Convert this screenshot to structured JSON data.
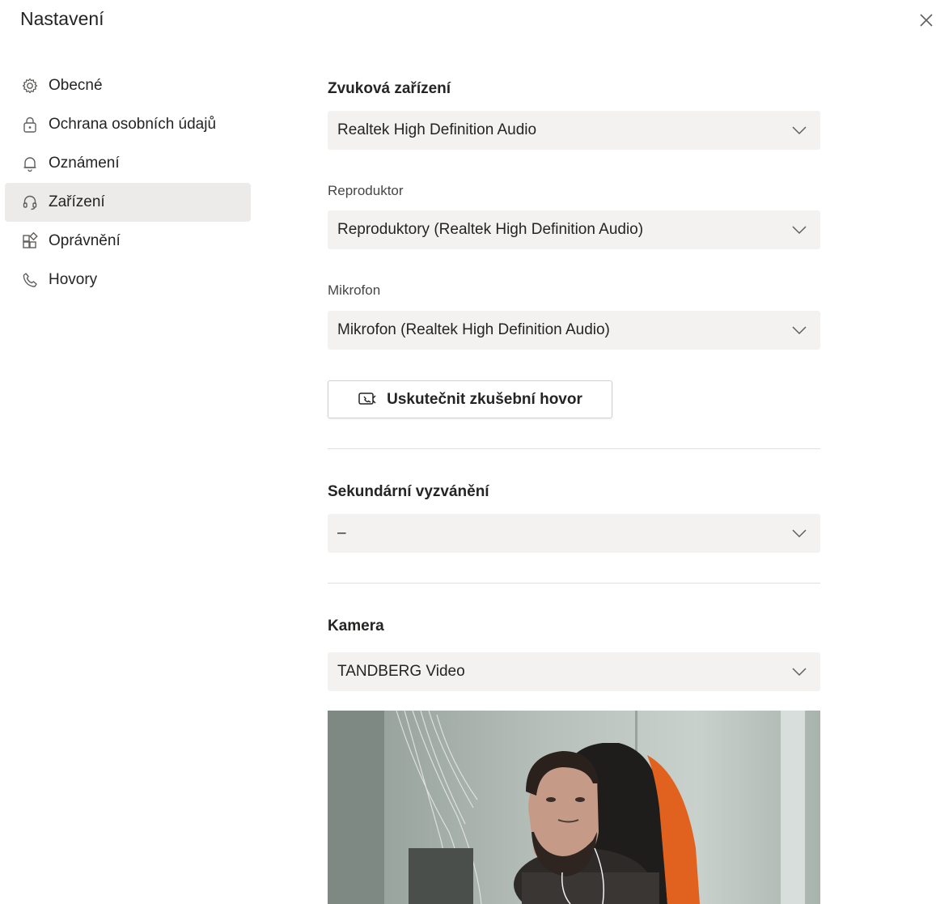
{
  "dialog": {
    "title": "Nastavení"
  },
  "nav": {
    "items": [
      {
        "label": "Obecné",
        "icon": "gear-icon"
      },
      {
        "label": "Ochrana osobních údajů",
        "icon": "lock-icon"
      },
      {
        "label": "Oznámení",
        "icon": "bell-icon"
      },
      {
        "label": "Zařízení",
        "icon": "headset-icon",
        "active": true
      },
      {
        "label": "Oprávnění",
        "icon": "apps-icon"
      },
      {
        "label": "Hovory",
        "icon": "phone-icon"
      }
    ]
  },
  "audio": {
    "heading": "Zvuková zařízení",
    "device": "Realtek High Definition Audio",
    "speaker_label": "Reproduktor",
    "speaker": "Reproduktory (Realtek High Definition Audio)",
    "mic_label": "Mikrofon",
    "mic": "Mikrofon (Realtek High Definition Audio)",
    "test_call": "Uskutečnit zkušební hovor"
  },
  "secondary": {
    "heading": "Sekundární vyzvánění",
    "value": "–"
  },
  "camera": {
    "heading": "Kamera",
    "device": "TANDBERG Video"
  }
}
